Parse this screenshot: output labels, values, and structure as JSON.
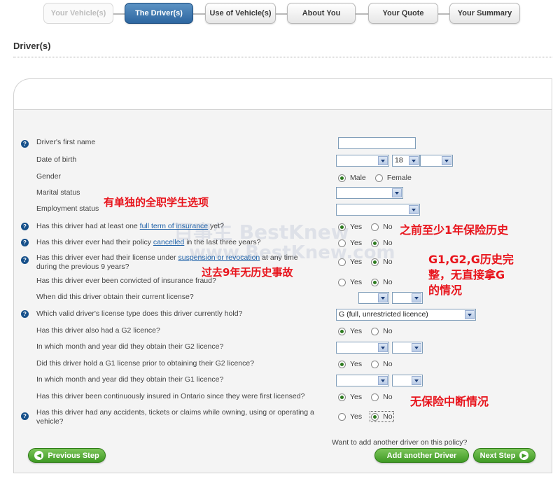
{
  "steps": [
    {
      "label": "Your Vehicle(s)",
      "state": "disabled"
    },
    {
      "label": "The Driver(s)",
      "state": "active"
    },
    {
      "label": "Use of Vehicle(s)",
      "state": "normal"
    },
    {
      "label": "About You",
      "state": "normal"
    },
    {
      "label": "Your Quote",
      "state": "normal"
    },
    {
      "label": "Your Summary",
      "state": "normal"
    }
  ],
  "page_title": "Driver(s)",
  "form": {
    "first_name": {
      "label": "Driver's first name",
      "value": ""
    },
    "dob": {
      "label": "Date of birth",
      "day": "18"
    },
    "gender": {
      "label": "Gender",
      "options": [
        "Male",
        "Female"
      ],
      "selected": "Male"
    },
    "marital": {
      "label": "Marital status"
    },
    "employment": {
      "label": "Employment status"
    },
    "q_full_term": {
      "pre": "Has this driver had at least one ",
      "link": "full term of insurance",
      "post": " yet?",
      "options": [
        "Yes",
        "No"
      ],
      "selected": "Yes"
    },
    "q_cancelled": {
      "pre": "Has this driver ever had their policy ",
      "link": "cancelled",
      "post": " in the last three years?",
      "options": [
        "Yes",
        "No"
      ],
      "selected": "No"
    },
    "q_suspension": {
      "pre": "Has this driver ever had their license under ",
      "link": "suspension or revocation",
      "post": " at any time during the previous 9 years?",
      "options": [
        "Yes",
        "No"
      ],
      "selected": "No"
    },
    "q_fraud": {
      "label": "Has this driver ever been convicted of insurance fraud?",
      "options": [
        "Yes",
        "No"
      ],
      "selected": "No"
    },
    "q_current_license": {
      "label": "When did this driver obtain their current license?"
    },
    "q_license_type": {
      "label": "Which valid driver's license type does this driver currently hold?",
      "value": "G (full, unrestricted licence)"
    },
    "q_g2": {
      "label": "Has this driver also had a G2 licence?",
      "options": [
        "Yes",
        "No"
      ],
      "selected": "Yes"
    },
    "q_g2_date": {
      "label": "In which month and year did they obtain their G2 licence?"
    },
    "q_g1": {
      "label": "Did this driver hold a G1 license prior to obtaining their G2 licence?",
      "options": [
        "Yes",
        "No"
      ],
      "selected": "Yes"
    },
    "q_g1_date": {
      "label": "In which month and year did they obtain their G1 licence?"
    },
    "q_continuous": {
      "label": "Has this driver been continuously insured in Ontario since they were first licensed?",
      "options": [
        "Yes",
        "No"
      ],
      "selected": "Yes"
    },
    "q_accidents": {
      "label": "Has this driver had any accidents, tickets or claims while owning, using or operating a vehicle?",
      "options": [
        "Yes",
        "No"
      ],
      "selected": "No"
    }
  },
  "annotations": {
    "student": "有单独的全职学生选项",
    "history": "之前至少1年保险历史",
    "nine_years": "过去9年无历史事故",
    "g_license": "G1,G2,G历史完整，无直接拿G的情况",
    "g_line1": "G1,G2,G历史完",
    "g_line2": "整，无直接拿G",
    "g_line3": "的情况",
    "no_gap": "无保险中断情况",
    "watermark1": "百事生 BestKnew",
    "watermark2": "www.BestKnew.com"
  },
  "buttons": {
    "previous": "Previous Step",
    "add_prompt": "Want to add another driver on this policy?",
    "add_driver": "Add another Driver",
    "next": "Next Step"
  },
  "colors": {
    "annotation_red": "#e8141c",
    "accent_blue": "#2d66a0",
    "button_green": "#3f9a25"
  }
}
